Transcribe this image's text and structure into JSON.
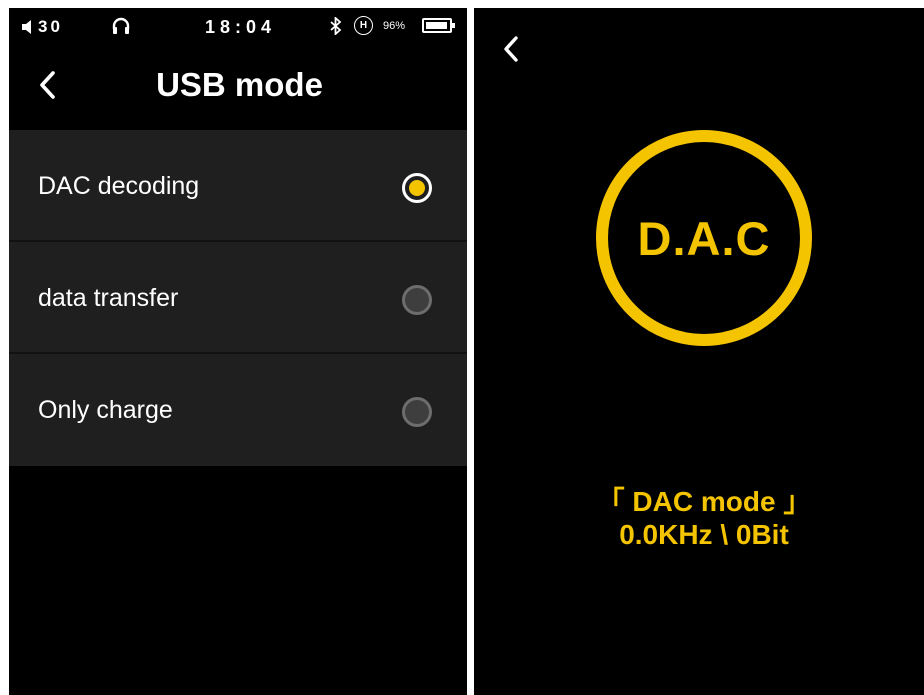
{
  "status_bar": {
    "volume": "30",
    "time": "18:04",
    "battery_percent": "96%",
    "battery_level": 0.96,
    "hires_mark": "H"
  },
  "left_screen": {
    "title": "USB mode",
    "options": [
      {
        "label": "DAC decoding",
        "selected": true
      },
      {
        "label": "data transfer",
        "selected": false
      },
      {
        "label": "Only charge",
        "selected": false
      }
    ]
  },
  "right_screen": {
    "logo": "D.A.C",
    "mode_label": "「 DAC mode 」",
    "sample_info": "0.0KHz \\ 0Bit"
  },
  "colors": {
    "accent": "#f5c400",
    "background": "#000000",
    "list_bg": "#1f1f1f"
  },
  "icons": [
    "volume-icon",
    "headphone-icon",
    "bluetooth-icon",
    "battery-icon",
    "back-chevron-icon"
  ]
}
